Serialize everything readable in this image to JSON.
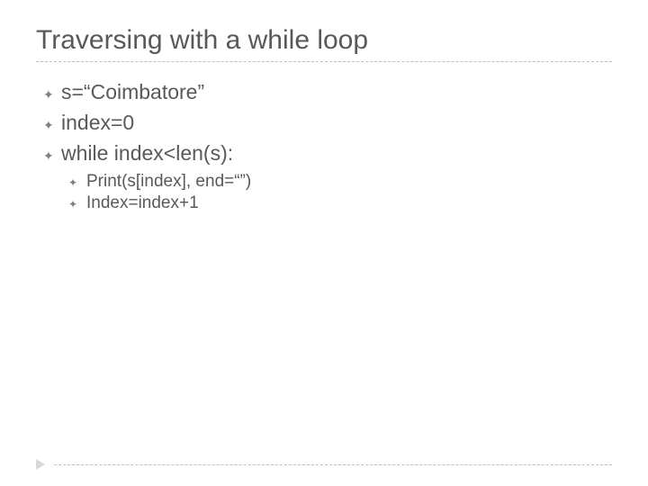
{
  "title": "Traversing with a while loop",
  "items": [
    {
      "text": "s=“Coimbatore”"
    },
    {
      "text": "index=0"
    },
    {
      "text": "while index<len(s):"
    }
  ],
  "subitems": [
    {
      "text": "Print(s[index], end=“”)"
    },
    {
      "text": "Index=index+1"
    }
  ],
  "bullet_glyph": "✦"
}
